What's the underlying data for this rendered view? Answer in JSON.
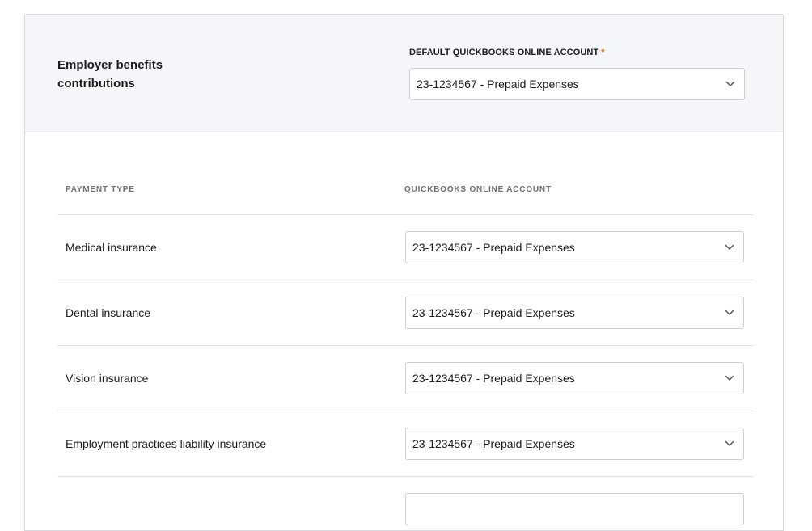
{
  "header": {
    "title": "Employer benefits contributions",
    "default_account_label": "DEFAULT QUICKBOOKS ONLINE ACCOUNT",
    "required_marker": "*",
    "default_account_value": "23-1234567 - Prepaid Expenses"
  },
  "table": {
    "col_payment_type": "PAYMENT TYPE",
    "col_account": "QUICKBOOKS ONLINE ACCOUNT",
    "rows": [
      {
        "payment_type": "Medical insurance",
        "account": "23-1234567 - Prepaid Expenses"
      },
      {
        "payment_type": "Dental insurance",
        "account": "23-1234567 - Prepaid Expenses"
      },
      {
        "payment_type": "Vision insurance",
        "account": "23-1234567 - Prepaid Expenses"
      },
      {
        "payment_type": "Employment practices liability insurance",
        "account": "23-1234567 - Prepaid Expenses"
      },
      {
        "payment_type": "",
        "account": ""
      }
    ]
  },
  "colors": {
    "header_bg": "#f5f6fa",
    "required_star": "#e05a1a",
    "border": "#d9d9dd"
  },
  "icons": {
    "dropdown": "chevron-down-icon"
  }
}
